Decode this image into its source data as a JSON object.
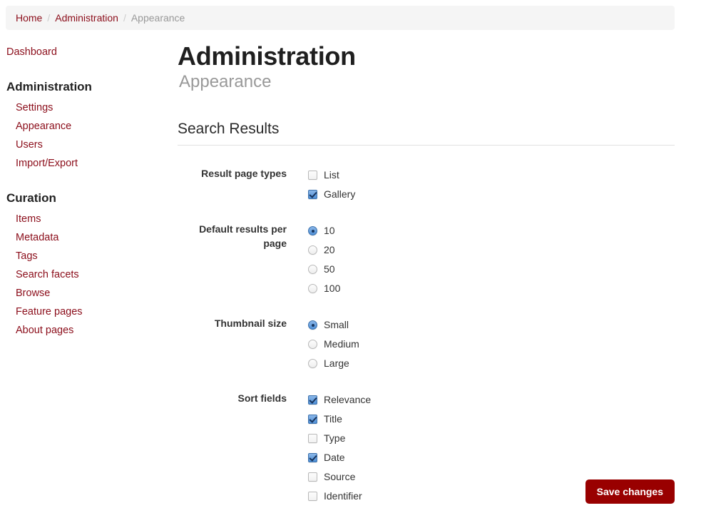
{
  "breadcrumb": {
    "separator": "/",
    "items": [
      {
        "label": "Home",
        "active": false
      },
      {
        "label": "Administration",
        "active": false
      },
      {
        "label": "Appearance",
        "active": true
      }
    ]
  },
  "sidebar": {
    "dashboard_label": "Dashboard",
    "groups": [
      {
        "heading": "Administration",
        "items": [
          {
            "label": "Settings"
          },
          {
            "label": "Appearance"
          },
          {
            "label": "Users"
          },
          {
            "label": "Import/Export"
          }
        ]
      },
      {
        "heading": "Curation",
        "items": [
          {
            "label": "Items"
          },
          {
            "label": "Metadata"
          },
          {
            "label": "Tags"
          },
          {
            "label": "Search facets"
          },
          {
            "label": "Browse"
          },
          {
            "label": "Feature pages"
          },
          {
            "label": "About pages"
          }
        ]
      }
    ]
  },
  "header": {
    "title": "Administration",
    "subtitle": "Appearance"
  },
  "section": {
    "title": "Search Results"
  },
  "form": {
    "fields": [
      {
        "label": "Result page types",
        "control": "checkbox",
        "options": [
          {
            "label": "List",
            "checked": false
          },
          {
            "label": "Gallery",
            "checked": true
          }
        ]
      },
      {
        "label": "Default results per page",
        "control": "radio",
        "options": [
          {
            "label": "10",
            "checked": true
          },
          {
            "label": "20",
            "checked": false
          },
          {
            "label": "50",
            "checked": false
          },
          {
            "label": "100",
            "checked": false
          }
        ]
      },
      {
        "label": "Thumbnail size",
        "control": "radio",
        "options": [
          {
            "label": "Small",
            "checked": true
          },
          {
            "label": "Medium",
            "checked": false
          },
          {
            "label": "Large",
            "checked": false
          }
        ]
      },
      {
        "label": "Sort fields",
        "control": "checkbox",
        "options": [
          {
            "label": "Relevance",
            "checked": true
          },
          {
            "label": "Title",
            "checked": true
          },
          {
            "label": "Type",
            "checked": false
          },
          {
            "label": "Date",
            "checked": true
          },
          {
            "label": "Source",
            "checked": false
          },
          {
            "label": "Identifier",
            "checked": false
          }
        ]
      }
    ]
  },
  "footer": {
    "save_label": "Save changes"
  },
  "colors": {
    "link": "#8b0d1a",
    "button": "#990000",
    "breadcrumb_bg": "#f5f5f5",
    "subtitle": "#999999",
    "control_accent": "#4f8fd6"
  }
}
